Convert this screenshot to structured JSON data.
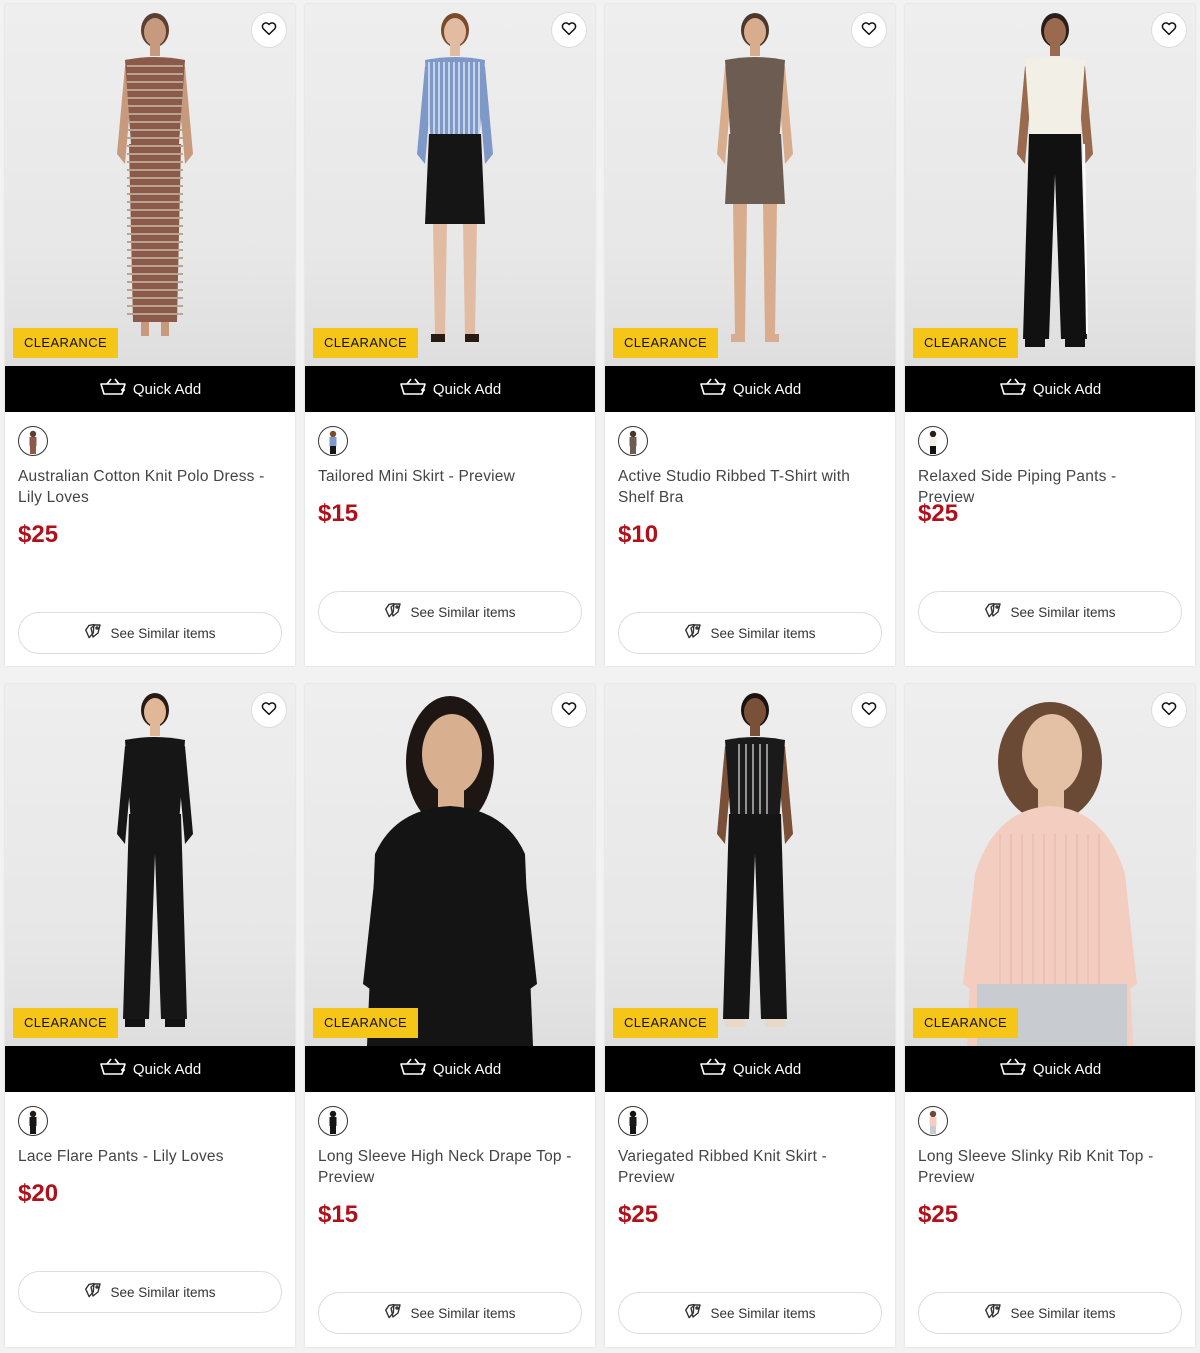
{
  "products": [
    {
      "title": "Australian Cotton Knit Polo Dress - Lily Loves",
      "price": "$25",
      "badge": "CLEARANCE",
      "quick_add_label": "Quick Add",
      "similar_label": "See Similar items",
      "wishlist_icon": "heart-outline-icon",
      "skin": "#c79a7e",
      "hair": "#5a4030",
      "top": "#8b5a4a",
      "bottom": "#8b5a4a",
      "shoes": "#f0ebe2",
      "pattern": "stripes"
    },
    {
      "title": "Tailored Mini Skirt - Preview",
      "price": "$15",
      "badge": "CLEARANCE",
      "quick_add_label": "Quick Add",
      "similar_label": "See Similar items",
      "wishlist_icon": "heart-outline-icon",
      "skin": "#e2bca2",
      "hair": "#7a4a2a",
      "top": "#7e98c8",
      "bottom": "#151515",
      "shoes": "#2a1a14",
      "pattern": "shirt"
    },
    {
      "title": "Active Studio Ribbed T-Shirt with Shelf Bra",
      "price": "$10",
      "badge": "CLEARANCE",
      "quick_add_label": "Quick Add",
      "similar_label": "See Similar items",
      "wishlist_icon": "heart-outline-icon",
      "skin": "#d8ad8e",
      "hair": "#4a382c",
      "top": "#6d5c52",
      "bottom": "#6d5c52",
      "shoes": "#d8ad8e",
      "pattern": "plain"
    },
    {
      "title": "Relaxed Side Piping Pants - Preview",
      "price": "$25",
      "badge": "CLEARANCE",
      "quick_add_label": "Quick Add",
      "similar_label": "See Similar items",
      "wishlist_icon": "heart-outline-icon",
      "skin": "#9a6a4e",
      "hair": "#2a1e18",
      "top": "#f1efe6",
      "bottom": "#111111",
      "shoes": "#111111",
      "pattern": "piping"
    },
    {
      "title": "Lace Flare Pants - Lily Loves",
      "price": "$20",
      "badge": "CLEARANCE",
      "quick_add_label": "Quick Add",
      "similar_label": "See Similar items",
      "wishlist_icon": "heart-outline-icon",
      "skin": "#e0b898",
      "hair": "#2a1a14",
      "top": "#161616",
      "bottom": "#161616",
      "shoes": "#111111",
      "pattern": "lace"
    },
    {
      "title": "Long Sleeve High Neck Drape Top - Preview",
      "price": "$15",
      "badge": "CLEARANCE",
      "quick_add_label": "Quick Add",
      "similar_label": "See Similar items",
      "wishlist_icon": "heart-outline-icon",
      "skin": "#d8b090",
      "hair": "#1e1612",
      "top": "#141414",
      "bottom": "#141414",
      "shoes": "#141414",
      "pattern": "closeup"
    },
    {
      "title": "Variegated Ribbed Knit Skirt - Preview",
      "price": "$25",
      "badge": "CLEARANCE",
      "quick_add_label": "Quick Add",
      "similar_label": "See Similar items",
      "wishlist_icon": "heart-outline-icon",
      "skin": "#7a5038",
      "hair": "#1a1210",
      "top": "#1a1a1a",
      "bottom": "#151515",
      "shoes": "#e8d8c8",
      "pattern": "vstripe"
    },
    {
      "title": "Long Sleeve Slinky Rib Knit Top - Preview",
      "price": "$25",
      "badge": "CLEARANCE",
      "quick_add_label": "Quick Add",
      "similar_label": "See Similar items",
      "wishlist_icon": "heart-outline-icon",
      "skin": "#e4c0a4",
      "hair": "#6a4a34",
      "top": "#f3cdc0",
      "bottom": "#c8cbcf",
      "shoes": "#c8cbcf",
      "pattern": "closeup"
    }
  ]
}
